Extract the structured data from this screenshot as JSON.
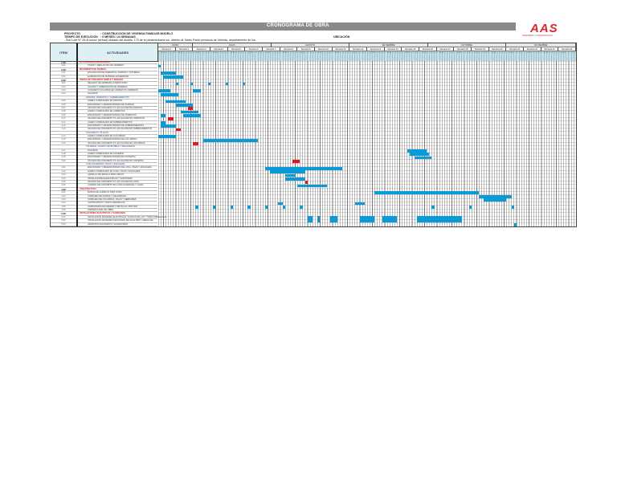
{
  "header": {
    "title": "CRONOGRAMA DE OBRA",
    "project_label": "PROYECTO",
    "project_value": ": CONSTRUCCIÓN DE VIVIENDA FAMILIAR MODELO",
    "time_label": "TIEMPO DE EJECUCIÓN",
    "time_value": ": 6 MESES / 24 SEMANAS",
    "location_line": ": Sub Lote N° 05-B sector (actual) ubicado del distrito, 170 de la panamericana sur, distrito de Santo Paulo provincia de Urbinita, departamento de Ica",
    "location_label": "UBICACIÓN",
    "logo_text": "AAS",
    "logo_sub": "INGENIERIA Y CONSTRUCCION"
  },
  "columns": {
    "item": "ITEM",
    "activities": "ACTIVIDADES"
  },
  "day_initials": [
    "L",
    "M",
    "M",
    "J",
    "V",
    "S",
    "D"
  ],
  "colors": {
    "bar": "#0a9ad7",
    "milestone": "#e8141a",
    "section": "#e8141a",
    "subsection": "#1f4aa0"
  },
  "months": [
    {
      "name": "JUNIO",
      "weeks": 2
    },
    {
      "name": "JULIO",
      "weeks": 4.5
    },
    {
      "name": "AGOSTO",
      "weeks": 4.5
    },
    {
      "name": "SETIEMBRE",
      "weeks": 4.5
    },
    {
      "name": "OCTUBRE",
      "weeks": 4.5
    },
    {
      "name": "NOVIEMBRE",
      "weeks": 4
    }
  ],
  "weeks": [
    "Semana 1",
    "Semana 2",
    "Semana 3",
    "Semana 4",
    "Semana 5",
    "Semana 6",
    "Semana 7",
    "Semana 8",
    "Semana 9",
    "Semana 10",
    "Semana 11",
    "Semana 12",
    "Semana 13",
    "Semana 14",
    "Semana 15",
    "Semana 16",
    "Semana 17",
    "Semana 18",
    "Semana 19",
    "Semana 20",
    "Semana 21",
    "Semana 22",
    "Semana 23",
    "Semana 24"
  ],
  "total_days": 168,
  "rows": [
    {
      "item": "1.00",
      "label": "ACTIVIDADES PRELIMINARES",
      "type": "section"
    },
    {
      "item": "1.01",
      "label": "TRAZO Y REPLANTEO DE TERRENO",
      "type": "item"
    },
    {
      "item": "2.00",
      "label": "MOVIMIENTO DE TIERRAS",
      "type": "section"
    },
    {
      "item": "2.01",
      "label": "EXCAVACIÓN DE CIMIENTOS, ZAPATAS Y CISTERNA",
      "type": "item"
    },
    {
      "item": "2.02",
      "label": "ELIMINACIÓN DE MATERIAL EXCEDENTE",
      "type": "item"
    },
    {
      "item": "3.00",
      "label": "OBRAS DE CONCRETO SIMPLE Y ARMADO",
      "type": "section"
    },
    {
      "item": "3.01",
      "label": "RELLENO DE AFIRMADO COMPACTADO",
      "type": "item"
    },
    {
      "item": "3.02",
      "label": "SOLADO Y CIMENTACIÓN DE TERRENO",
      "type": "item"
    },
    {
      "item": "3.03",
      "label": "CONCRETO CICLÓPEO EN CIMIENTOS CORRIDOS",
      "type": "item"
    },
    {
      "item": "3.04",
      "label": "SOLADOS",
      "type": "item"
    },
    {
      "item": "",
      "label": "ZAPATAS, CIMIENTOS Y SOBRECIMIENTOS",
      "type": "sub"
    },
    {
      "item": "3.05",
      "label": "ACERO CORRUGADO EN ZAPATAS",
      "type": "item"
    },
    {
      "item": "3.06",
      "label": "ENCOFRADO Y DESENCOFRADO DE ZAPATAS",
      "type": "item"
    },
    {
      "item": "3.07",
      "label": "VACIADO DE CONCRETO F'C 210 KG/CM2 EN ZAPATAS",
      "type": "item"
    },
    {
      "item": "3.08",
      "label": "ACERO CORRUGADO EN CIMIENTOS",
      "type": "item"
    },
    {
      "item": "3.09",
      "label": "ENCOFRADO Y DESENCOFRADO DE CIMIENTOS",
      "type": "item"
    },
    {
      "item": "3.10",
      "label": "VACIADO DE CONCRETO F'C 210 KG/CM2 EN CIMIENTOS",
      "type": "item"
    },
    {
      "item": "3.11",
      "label": "ACERO CORRUGADO EN SOBRECIMIENTOS",
      "type": "item"
    },
    {
      "item": "3.12",
      "label": "ENCOFRADO Y DESENCOFRADO DE SOBRECIMIENTOS",
      "type": "item"
    },
    {
      "item": "3.13",
      "label": "VACIADO DE CONCRETO F'C 210 KG/CM2 EN SOBRECIMIENTOS",
      "type": "item"
    },
    {
      "item": "",
      "label": "COLUMNAS Y PLACAS",
      "type": "sub"
    },
    {
      "item": "3.14",
      "label": "ACERO CORRUGADO EN COLUMNAS",
      "type": "item"
    },
    {
      "item": "3.15",
      "label": "ENCOFRADO Y DESENCOFRADO DE COLUMNAS",
      "type": "item"
    },
    {
      "item": "3.16",
      "label": "VACIADO DE CONCRETO F'C 210 KG/CM2 EN COLUMNAS",
      "type": "item"
    },
    {
      "item": "",
      "label": "CISTERNA, CUARTO DE BOMBAS Y REGADERAS",
      "type": "sub"
    },
    {
      "item": "3.17",
      "label": "SOLADOS",
      "type": "item"
    },
    {
      "item": "3.18",
      "label": "ACERO CORRUGADO EN CISTERNA",
      "type": "item"
    },
    {
      "item": "3.19",
      "label": "ENCOFRADO Y DESENCOFRADO EN CISTERNA",
      "type": "item"
    },
    {
      "item": "3.20",
      "label": "VACIADO DE CONCRETO F'C 210 KG/CM2 EN CISTERNA",
      "type": "item"
    },
    {
      "item": "",
      "label": "LOSA ALIGERADA, VIGAS Y ESCALERA",
      "type": "sub"
    },
    {
      "item": "3.21",
      "label": "ENCOFRADO Y DESENCOFRADO DE LOSA, VIGAS Y ESCALERA",
      "type": "item"
    },
    {
      "item": "3.22",
      "label": "ACERO CORRUGADO EN LOSA, VIGAS Y ESCALERA",
      "type": "item"
    },
    {
      "item": "3.23",
      "label": "LADRILLO DE ARCILLA PARA TECHO",
      "type": "item"
    },
    {
      "item": "3.24",
      "label": "INSTALACIONES ELÉCTRICAS Y SANITARIAS",
      "type": "item"
    },
    {
      "item": "3.25",
      "label": "VACIADO DE CONCRETO F'C 210 KG/CM2 EN LOSA",
      "type": "item"
    },
    {
      "item": "3.26",
      "label": "CURADO DE CONCRETO EN LOSA ALIGERADA Y VIGAS",
      "type": "item"
    },
    {
      "item": "4.00",
      "label": "ARQUITECTURA",
      "type": "section"
    },
    {
      "item": "4.01",
      "label": "MUROS DE LADRILLO KING KONG",
      "type": "item"
    },
    {
      "item": "4.02",
      "label": "TARRAJEO DE MUROS Y CIELORRASO",
      "type": "item"
    },
    {
      "item": "4.03",
      "label": "TARRAJEO DE COLUMNAS, VIGAS Y DERRAMES",
      "type": "item"
    },
    {
      "item": "4.04",
      "label": "CONTRAPISOS Y PISOS CERÁMICOS",
      "type": "item"
    },
    {
      "item": "4.05",
      "label": "CARPINTERÍA DE MADERA Y METÁLICA, PINTURA",
      "type": "item"
    },
    {
      "item": "4.06",
      "label": "LIMPIEZA FINAL DE OBRA",
      "type": "item"
    },
    {
      "item": "5.00",
      "label": "INSTALACIONES ELÉCTRICAS Y SANITARIAS",
      "type": "section"
    },
    {
      "item": "5.01",
      "label": "INSTALACIÓN DE REDES ELÉCTRICAS, SALIDAS DE LUZ Y TOMACORRIENTES",
      "type": "item"
    },
    {
      "item": "5.02",
      "label": "INSTALACIÓN DE REDES SANITARIAS DE AGUA FRÍA Y DESAGÜE",
      "type": "item"
    },
    {
      "item": "5.03",
      "label": "APARATOS SANITARIOS Y ACCESORIOS",
      "type": "item"
    }
  ],
  "chart_data": {
    "type": "gantt",
    "unit": "day",
    "bars": [
      {
        "row": 1,
        "start": 0,
        "days": 1,
        "kind": "task"
      },
      {
        "row": 3,
        "start": 1,
        "days": 6,
        "kind": "task"
      },
      {
        "row": 4,
        "start": 2,
        "days": 8,
        "kind": "task"
      },
      {
        "row": 6,
        "start": 7,
        "days": 1,
        "kind": "task"
      },
      {
        "row": 6,
        "start": 13,
        "days": 1,
        "kind": "task"
      },
      {
        "row": 6,
        "start": 20,
        "days": 1,
        "kind": "task"
      },
      {
        "row": 6,
        "start": 27,
        "days": 1,
        "kind": "task"
      },
      {
        "row": 6,
        "start": 34,
        "days": 1,
        "kind": "task"
      },
      {
        "row": 8,
        "start": 0,
        "days": 5,
        "kind": "task"
      },
      {
        "row": 8,
        "start": 14,
        "days": 3,
        "kind": "task"
      },
      {
        "row": 9,
        "start": 1,
        "days": 7,
        "kind": "task"
      },
      {
        "row": 11,
        "start": 3,
        "days": 8,
        "kind": "task"
      },
      {
        "row": 12,
        "start": 7,
        "days": 7,
        "kind": "task"
      },
      {
        "row": 13,
        "start": 12,
        "days": 2,
        "kind": "milestone"
      },
      {
        "row": 14,
        "start": 9,
        "days": 7,
        "kind": "task"
      },
      {
        "row": 15,
        "start": 1,
        "days": 2,
        "kind": "task"
      },
      {
        "row": 15,
        "start": 10,
        "days": 7,
        "kind": "task"
      },
      {
        "row": 16,
        "start": 4,
        "days": 2,
        "kind": "milestone"
      },
      {
        "row": 17,
        "start": 1,
        "days": 2,
        "kind": "task"
      },
      {
        "row": 18,
        "start": 1,
        "days": 6,
        "kind": "task"
      },
      {
        "row": 19,
        "start": 7,
        "days": 2,
        "kind": "milestone"
      },
      {
        "row": 21,
        "start": 0,
        "days": 7,
        "kind": "task"
      },
      {
        "row": 22,
        "start": 18,
        "days": 22,
        "kind": "task"
      },
      {
        "row": 23,
        "start": 14,
        "days": 2,
        "kind": "milestone"
      },
      {
        "row": 25,
        "start": 100,
        "days": 8,
        "kind": "task"
      },
      {
        "row": 26,
        "start": 101,
        "days": 8,
        "kind": "task"
      },
      {
        "row": 27,
        "start": 103,
        "days": 7,
        "kind": "task"
      },
      {
        "row": 28,
        "start": 54,
        "days": 3,
        "kind": "milestone"
      },
      {
        "row": 30,
        "start": 43,
        "days": 31,
        "kind": "task"
      },
      {
        "row": 31,
        "start": 45,
        "days": 14,
        "kind": "task"
      },
      {
        "row": 32,
        "start": 51,
        "days": 4,
        "kind": "task"
      },
      {
        "row": 33,
        "start": 51,
        "days": 8,
        "kind": "task"
      },
      {
        "row": 34,
        "start": 59,
        "days": 1,
        "kind": "milestone"
      },
      {
        "row": 35,
        "start": 56,
        "days": 12,
        "kind": "task"
      },
      {
        "row": 37,
        "start": 87,
        "days": 42,
        "kind": "task"
      },
      {
        "row": 38,
        "start": 129,
        "days": 13,
        "kind": "task"
      },
      {
        "row": 39,
        "start": 131,
        "days": 9,
        "kind": "task"
      },
      {
        "row": 40,
        "start": 48,
        "days": 2,
        "kind": "task"
      },
      {
        "row": 40,
        "start": 79,
        "days": 4,
        "kind": "task"
      },
      {
        "row": 41,
        "start": 15,
        "days": 1,
        "kind": "task"
      },
      {
        "row": 41,
        "start": 22,
        "days": 1,
        "kind": "task"
      },
      {
        "row": 41,
        "start": 29,
        "days": 1,
        "kind": "task"
      },
      {
        "row": 41,
        "start": 36,
        "days": 1,
        "kind": "task"
      },
      {
        "row": 41,
        "start": 43,
        "days": 1,
        "kind": "task"
      },
      {
        "row": 41,
        "start": 50,
        "days": 1,
        "kind": "task"
      },
      {
        "row": 41,
        "start": 57,
        "days": 1,
        "kind": "task"
      },
      {
        "row": 41,
        "start": 110,
        "days": 1,
        "kind": "task"
      },
      {
        "row": 41,
        "start": 125,
        "days": 1,
        "kind": "task"
      },
      {
        "row": 41,
        "start": 142,
        "days": 1,
        "kind": "task"
      },
      {
        "row": 44,
        "start": 60,
        "days": 2,
        "span": 2,
        "kind": "task"
      },
      {
        "row": 44,
        "start": 64,
        "days": 1,
        "span": 2,
        "kind": "task"
      },
      {
        "row": 44,
        "start": 69,
        "days": 3,
        "span": 2,
        "kind": "task"
      },
      {
        "row": 44,
        "start": 81,
        "days": 6,
        "span": 2,
        "kind": "task"
      },
      {
        "row": 44,
        "start": 90,
        "days": 6,
        "span": 2,
        "kind": "task"
      },
      {
        "row": 44,
        "start": 104,
        "days": 18,
        "span": 2,
        "kind": "task"
      },
      {
        "row": 46,
        "start": 143,
        "days": 1,
        "kind": "task"
      }
    ]
  }
}
